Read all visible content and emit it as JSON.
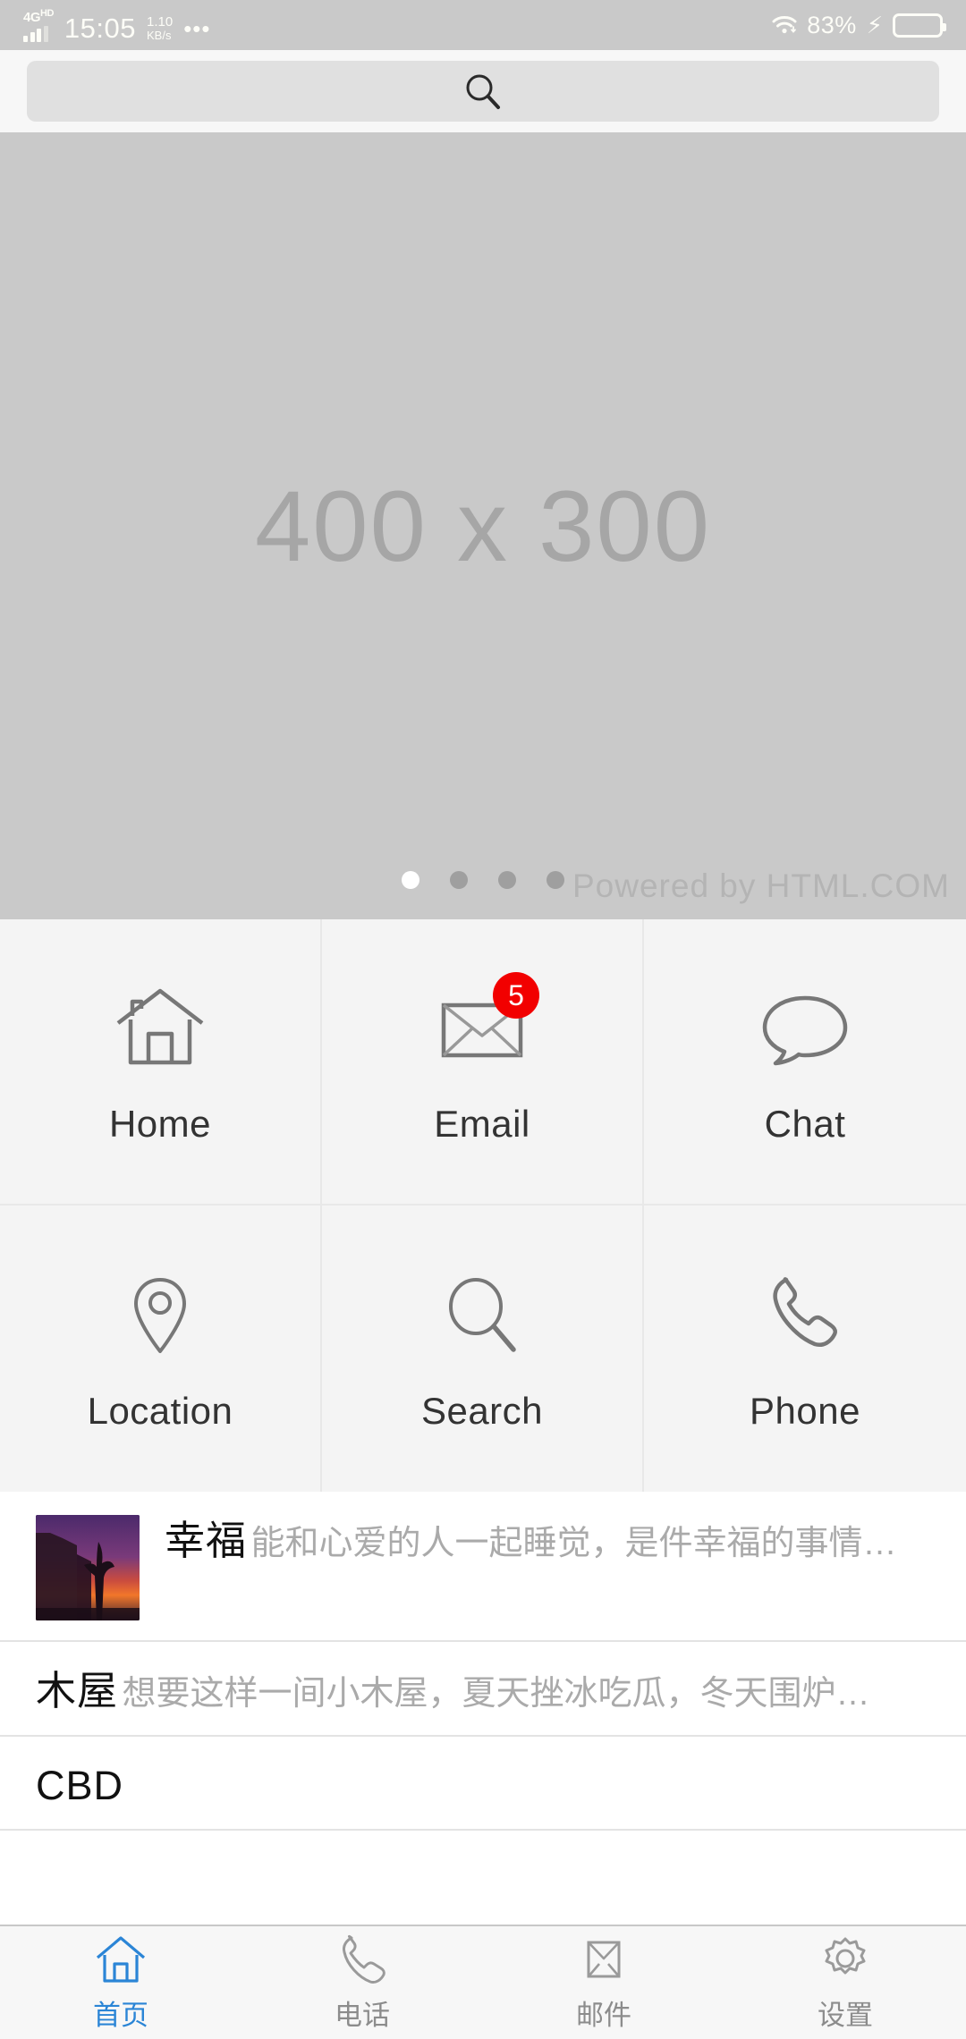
{
  "statusbar": {
    "network_label": "4G",
    "network_sup": "HD",
    "time": "15:05",
    "data_rate_value": "1.10",
    "data_rate_unit": "KB/s",
    "overflow_icon": "more-horizontal-icon",
    "wifi_icon": "wifi-download-icon",
    "battery_percent": "83%",
    "charging_icon": "lightning-bolt-icon",
    "battery_icon": "battery-icon",
    "battery_level": 83
  },
  "search": {
    "icon": "search-icon",
    "placeholder": "",
    "value": ""
  },
  "carousel": {
    "placeholder_text": "400 x 300",
    "watermark": "Powered by HTML.COM",
    "dot_count": 4,
    "active_dot": 0
  },
  "grid": {
    "items": [
      {
        "label": "Home",
        "icon": "home-icon",
        "badge": ""
      },
      {
        "label": "Email",
        "icon": "envelope-icon",
        "badge": "5"
      },
      {
        "label": "Chat",
        "icon": "chat-bubble-icon",
        "badge": ""
      },
      {
        "label": "Location",
        "icon": "map-pin-icon",
        "badge": ""
      },
      {
        "label": "Search",
        "icon": "magnifier-icon",
        "badge": ""
      },
      {
        "label": "Phone",
        "icon": "phone-icon",
        "badge": ""
      }
    ]
  },
  "list": {
    "items": [
      {
        "title": "幸福",
        "subtitle": "能和心爱的人一起睡觉，是件幸福的事情…",
        "thumbnail": "sunset-city-thumbnail"
      },
      {
        "title": "木屋",
        "subtitle": "想要这样一间小木屋，夏天挫冰吃瓜，冬天围炉…",
        "thumbnail": ""
      },
      {
        "title": "CBD",
        "subtitle": "",
        "thumbnail": ""
      }
    ]
  },
  "tabbar": {
    "items": [
      {
        "label": "首页",
        "icon": "home-icon",
        "active": true
      },
      {
        "label": "电话",
        "icon": "phone-icon",
        "active": false
      },
      {
        "label": "邮件",
        "icon": "envelope-icon",
        "active": false
      },
      {
        "label": "设置",
        "icon": "gear-icon",
        "active": false
      }
    ]
  },
  "colors": {
    "accent": "#2b85d6",
    "badge": "#f20000",
    "statusbar_bg": "#c9c9c9",
    "carousel_bg": "#c9c9c9",
    "grid_bg": "#f4f4f4"
  }
}
